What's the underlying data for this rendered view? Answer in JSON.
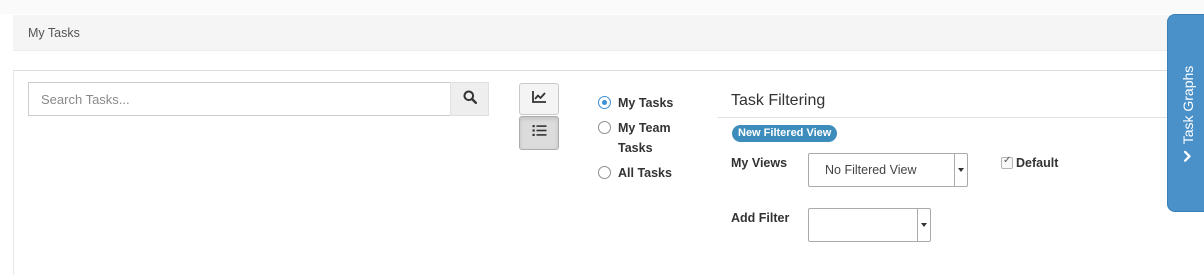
{
  "breadcrumb": {
    "title": "My Tasks"
  },
  "search": {
    "placeholder": "Search Tasks..."
  },
  "icons": {
    "search": "search-icon",
    "graph_view": "area-chart-icon",
    "list_view": "list-icon",
    "side_tab": "chevron-right-icon"
  },
  "scope": {
    "options": [
      {
        "label": "My Tasks",
        "checked": true
      },
      {
        "label": "My Team Tasks",
        "checked": false
      },
      {
        "label": "All Tasks",
        "checked": false
      }
    ]
  },
  "filtering": {
    "title": "Task Filtering",
    "new_view_button": "New Filtered View",
    "my_views_label": "My Views",
    "my_views_value": "No Filtered View",
    "default_label": "Default",
    "default_checked": true,
    "add_filter_label": "Add Filter",
    "add_filter_value": ""
  },
  "side_tab": {
    "label": "Task Graphs"
  },
  "colors": {
    "accent": "#3c8dbc",
    "side_tab": "#4a91c9",
    "radio_checked": "#3b8fd6"
  }
}
